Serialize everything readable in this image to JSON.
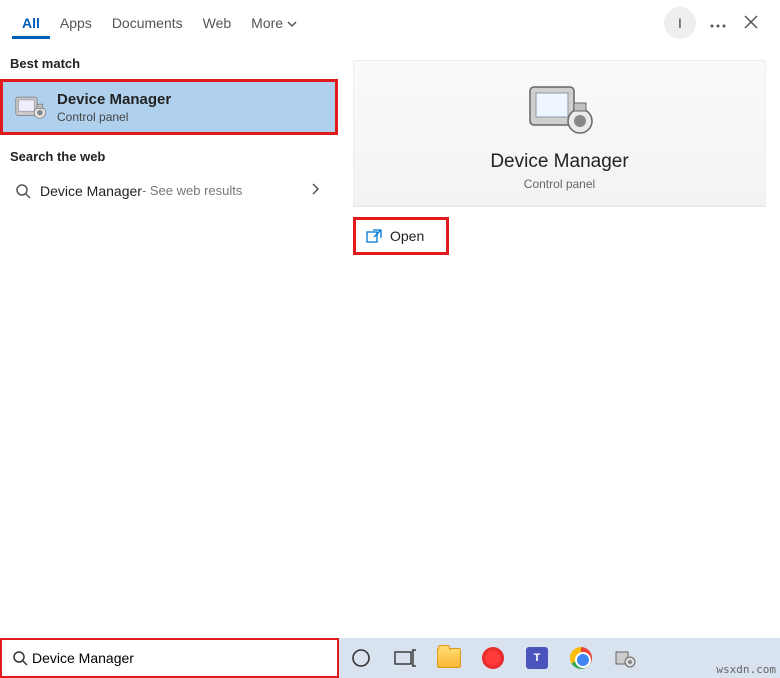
{
  "tabs": {
    "all": "All",
    "apps": "Apps",
    "documents": "Documents",
    "web": "Web",
    "more": "More"
  },
  "avatar_initial": "I",
  "sections": {
    "best_match": "Best match",
    "search_web": "Search the web"
  },
  "best_match": {
    "title": "Device Manager",
    "subtitle": "Control panel"
  },
  "web_result": {
    "term": "Device Manager",
    "suffix": " - See web results"
  },
  "preview": {
    "title": "Device Manager",
    "subtitle": "Control panel"
  },
  "actions": {
    "open": "Open"
  },
  "search": {
    "value": "Device Manager"
  },
  "watermark": "wsxdn.com"
}
